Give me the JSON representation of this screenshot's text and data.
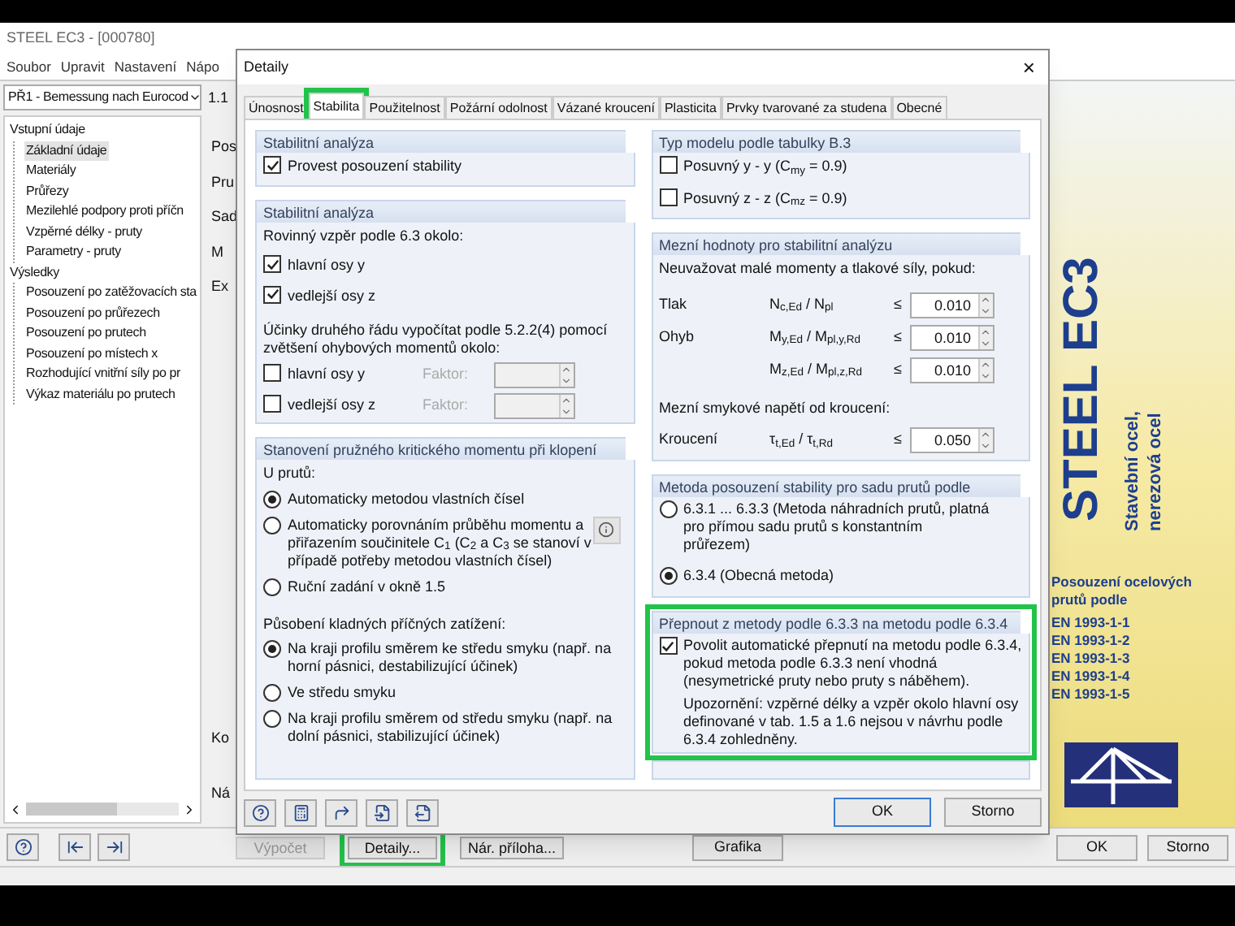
{
  "window": {
    "title": "STEEL EC3 - [000780]"
  },
  "menu": [
    "Soubor",
    "Upravit",
    "Nastavení",
    "Nápo"
  ],
  "case_select": {
    "value": "PŘ1 - Bemessung nach Eurocod"
  },
  "tree": [
    {
      "label": "Vstupní údaje",
      "selected": false,
      "children": [
        {
          "label": "Základní údaje",
          "selected": true
        },
        {
          "label": "Materiály",
          "selected": false
        },
        {
          "label": "Průřezy",
          "selected": false
        },
        {
          "label": "Mezilehlé podpory proti příčn",
          "selected": false
        },
        {
          "label": "Vzpěrné délky - pruty",
          "selected": false
        },
        {
          "label": "Parametry - pruty",
          "selected": false
        }
      ]
    },
    {
      "label": "Výsledky",
      "selected": false,
      "children": [
        {
          "label": "Posouzení po zatěžovacích sta",
          "selected": false
        },
        {
          "label": "Posouzení po průřezech",
          "selected": false
        },
        {
          "label": "Posouzení po prutech",
          "selected": false
        },
        {
          "label": "Posouzení po místech x",
          "selected": false
        },
        {
          "label": "Rozhodující vnitřní síly po pr",
          "selected": false
        },
        {
          "label": "Výkaz materiálu po prutech",
          "selected": false
        }
      ]
    }
  ],
  "middle_panel": {
    "header": "1.1",
    "labels": [
      "Pos",
      "Pru",
      "Sad",
      "M",
      "Ex"
    ],
    "bottom_labels": [
      "Ko",
      "Ná"
    ]
  },
  "product_image": {
    "title": "STEEL EC3",
    "subtitle": [
      "Stavební ocel,",
      "nerezová ocel"
    ],
    "caption": "Posouzení ocelových prutů podle",
    "standards": [
      "EN 1993-1-1",
      "EN 1993-1-2",
      "EN 1993-1-3",
      "EN 1993-1-4",
      "EN 1993-1-5"
    ]
  },
  "bottom_bar": {
    "buttons": [
      {
        "label": "Výpočet",
        "disabled": true,
        "highlighted": false
      },
      {
        "label": "Detaily...",
        "disabled": false,
        "highlighted": true
      },
      {
        "label": "Nár. příloha...",
        "disabled": false,
        "highlighted": false
      }
    ],
    "graphics": "Grafika",
    "ok": "OK",
    "cancel": "Storno"
  },
  "dialog": {
    "title": "Detaily",
    "close": "×",
    "tabs": [
      {
        "label": "Únosnost",
        "selected": false,
        "highlighted": false
      },
      {
        "label": "Stabilita",
        "selected": true,
        "highlighted": true
      },
      {
        "label": "Použitelnost",
        "selected": false,
        "highlighted": false
      },
      {
        "label": "Požární odolnost",
        "selected": false,
        "highlighted": false
      },
      {
        "label": "Vázané kroucení",
        "selected": false,
        "highlighted": false
      },
      {
        "label": "Plasticita",
        "selected": false,
        "highlighted": false
      },
      {
        "label": "Prvky tvarované za studena",
        "selected": false,
        "highlighted": false
      },
      {
        "label": "Obecné",
        "selected": false,
        "highlighted": false
      }
    ],
    "stability_analysis": {
      "title": "Stabilitní analýza",
      "checkbox": {
        "label": "Provest posouzení stability",
        "checked": true
      }
    },
    "stability_analysis_2": {
      "title": "Stabilitní analýza",
      "buckling_label": "Rovinný vzpěr podle 6.3 okolo:",
      "buckling": [
        {
          "label": "hlavní osy y",
          "checked": true
        },
        {
          "label": "vedlejší osy z",
          "checked": true
        }
      ],
      "second_order_label": "Účinky druhého řádu vypočítat podle 5.2.2(4) pomocí zvětšení ohybových momentů okolo:",
      "second_order": [
        {
          "label": "hlavní osy y",
          "checked": false,
          "factor_label": "Faktor:",
          "factor_disabled": true
        },
        {
          "label": "vedlejší osy z",
          "checked": false,
          "factor_label": "Faktor:",
          "factor_disabled": true
        }
      ]
    },
    "critical_moment": {
      "title": "Stanovení pružného kritického momentu při klopení",
      "members_label": "U prutů:",
      "methods": [
        {
          "label": "Automaticky metodou vlastních čísel",
          "selected": true,
          "info": false
        },
        {
          "label": "Automaticky porovnáním průběhu momentu a přiřazením součinitele C$_{1}$ (C$_{2}$ a C$_{3}$ se stanoví v případě potřeby metodou vlastních čísel)",
          "selected": false,
          "info": true
        },
        {
          "label": "Ruční zadání v okně 1.5",
          "selected": false,
          "info": false
        }
      ],
      "load_label": "Působení kladných příčných zatížení:",
      "load_positions": [
        {
          "label": "Na kraji profilu směrem ke středu smyku (např. na horní pásnici, destabilizující účinek)",
          "selected": true
        },
        {
          "label": "Ve středu smyku",
          "selected": false
        },
        {
          "label": "Na kraji profilu směrem od středu smyku (např. na dolní pásnici, stabilizující účinek)",
          "selected": false
        }
      ]
    },
    "model_type": {
      "title": "Typ modelu podle tabulky B.3",
      "options": [
        {
          "label": "Posuvný y - y (C$_{my}$ = 0.9)",
          "checked": false
        },
        {
          "label": "Posuvný z - z (C$_{mz}$ = 0.9)",
          "checked": false
        }
      ]
    },
    "limits": {
      "title": "Mezní hodnoty pro stabilitní analýzu",
      "intro": "Neuvažovat malé momenty a tlakové síly, pokud:",
      "rows": [
        {
          "label": "Tlak",
          "formula": "N$_{c,Ed}$ / N$_{pl}$",
          "sign": "≤",
          "value": "0.010"
        },
        {
          "label": "Ohyb",
          "formula": "M$_{y,Ed}$ / M$_{pl,y,Rd}$",
          "sign": "≤",
          "value": "0.010"
        },
        {
          "formula": "M$_{z,Ed}$ / M$_{pl,z,Rd}$",
          "sign": "≤",
          "value": "0.010"
        }
      ],
      "torsion_intro": "Mezní smykové napětí od kroucení:",
      "torsion_rows": [
        {
          "label": "Kroucení",
          "formula": "τ$_{t,Ed}$ / τ$_{t,Rd}$",
          "sign": "≤",
          "value": "0.050"
        }
      ]
    },
    "method": {
      "title": "Metoda posouzení stability pro sadu prutů podle",
      "options": [
        {
          "label": "6.3.1 ... 6.3.3 (Metoda náhradních prutů, platná pro přímou sadu prutů s konstantním průřezem)",
          "selected": false
        },
        {
          "label": "6.3.4 (Obecná metoda)",
          "selected": true
        }
      ]
    },
    "switch_method": {
      "title": "Přepnout z metody podle 6.3.3 na metodu podle 6.3.4",
      "highlighted": true,
      "checkbox": {
        "label": "Povolit automatické přepnutí na metodu podle 6.3.4, pokud metoda podle 6.3.3 není vhodná (nesymetrické pruty nebo pruty s náběhem).",
        "checked": true
      },
      "note": "Upozornění: vzpěrné délky a vzpěr okolo hlavní osy definované v tab. 1.5 a 1.6 nejsou v návrhu podle 6.3.4 zohledněny."
    },
    "ok": "OK",
    "cancel": "Storno"
  }
}
